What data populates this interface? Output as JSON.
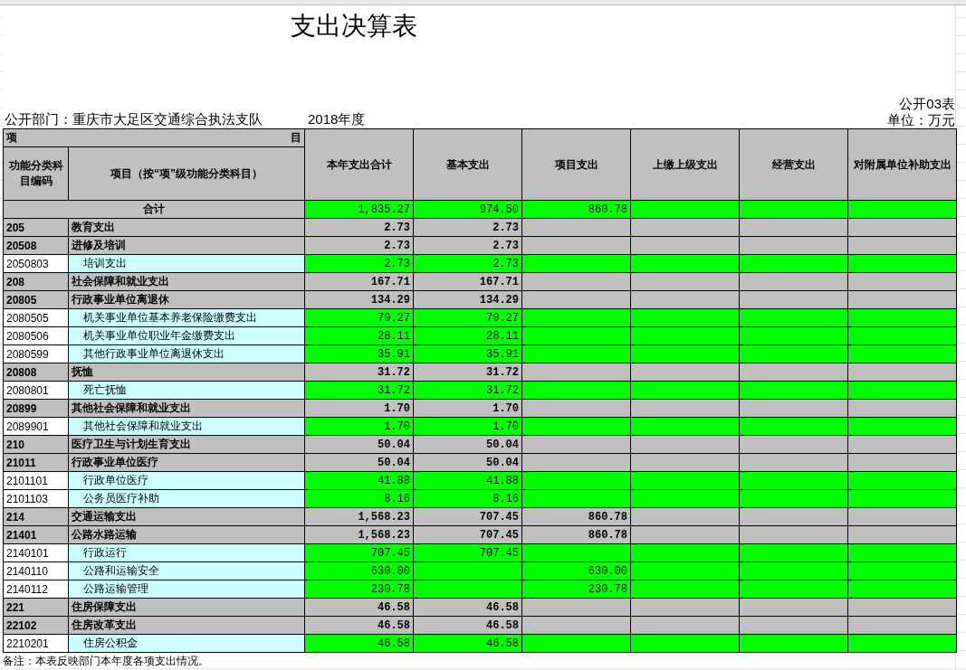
{
  "title": "支出决算表",
  "form_no": "公开03表",
  "department": "公开部门：重庆市大足区交通综合执法支队",
  "year": "2018年度",
  "unit": "单位：万元",
  "header": {
    "group": "项",
    "group_end": "目",
    "code": "功能分类科目编码",
    "name": "项目（按“项”级功能分类科目）",
    "columns": [
      "本年支出合计",
      "基本支出",
      "项目支出",
      "上缴上级支出",
      "经营支出",
      "对附属单位补助支出"
    ]
  },
  "total": {
    "label": "合计",
    "total": "1,835.27",
    "basic": "974.50",
    "project": "860.78"
  },
  "rows": [
    {
      "kind": "category",
      "code": "205",
      "name": "教育支出",
      "total": "2.73",
      "basic": "2.73"
    },
    {
      "kind": "category",
      "code": "20508",
      "name": "进修及培训",
      "total": "2.73",
      "basic": "2.73"
    },
    {
      "kind": "item",
      "code": "2050803",
      "name": "培训支出",
      "total": "2.73",
      "basic": "2.73"
    },
    {
      "kind": "category",
      "code": "208",
      "name": "社会保障和就业支出",
      "total": "167.71",
      "basic": "167.71"
    },
    {
      "kind": "category",
      "code": "20805",
      "name": "行政事业单位离退休",
      "total": "134.29",
      "basic": "134.29"
    },
    {
      "kind": "item",
      "code": "2080505",
      "name": "机关事业单位基本养老保险缴费支出",
      "total": "70.27",
      "basic": "70.27"
    },
    {
      "kind": "item",
      "code": "2080506",
      "name": "机关事业单位职业年金缴费支出",
      "total": "28.11",
      "basic": "28.11"
    },
    {
      "kind": "item",
      "code": "2080599",
      "name": "其他行政事业单位离退休支出",
      "total": "35.91",
      "basic": "35.91"
    },
    {
      "kind": "category",
      "code": "20808",
      "name": "抚恤",
      "total": "31.72",
      "basic": "31.72"
    },
    {
      "kind": "item",
      "code": "2080801",
      "name": "死亡抚恤",
      "total": "31.72",
      "basic": "31.72"
    },
    {
      "kind": "category",
      "code": "20899",
      "name": "其他社会保障和就业支出",
      "total": "1.70",
      "basic": "1.70"
    },
    {
      "kind": "item",
      "code": "2089901",
      "name": "其他社会保障和就业支出",
      "total": "1.70",
      "basic": "1.70"
    },
    {
      "kind": "category",
      "code": "210",
      "name": "医疗卫生与计划生育支出",
      "total": "50.04",
      "basic": "50.04"
    },
    {
      "kind": "category",
      "code": "21011",
      "name": "行政事业单位医疗",
      "total": "50.04",
      "basic": "50.04"
    },
    {
      "kind": "item",
      "code": "2101101",
      "name": "行政单位医疗",
      "total": "41.88",
      "basic": "41.88"
    },
    {
      "kind": "item",
      "code": "2101103",
      "name": "公务员医疗补助",
      "total": "8.16",
      "basic": "8.16"
    },
    {
      "kind": "category",
      "code": "214",
      "name": "交通运输支出",
      "total": "1,568.23",
      "basic": "707.45",
      "project": "860.78"
    },
    {
      "kind": "category",
      "code": "21401",
      "name": "公路水路运输",
      "total": "1,568.23",
      "basic": "707.45",
      "project": "860.78"
    },
    {
      "kind": "item",
      "code": "2140101",
      "name": "行政运行",
      "total": "707.45",
      "basic": "707.45"
    },
    {
      "kind": "item",
      "code": "2140110",
      "name": "公路和运输安全",
      "total": "630.00",
      "project": "630.00"
    },
    {
      "kind": "item",
      "code": "2140112",
      "name": "公路运输管理",
      "total": "230.78",
      "project": "230.78"
    },
    {
      "kind": "category",
      "code": "221",
      "name": "住房保障支出",
      "total": "46.58",
      "basic": "46.58"
    },
    {
      "kind": "category",
      "code": "22102",
      "name": "住房改革支出",
      "total": "46.58",
      "basic": "46.58"
    },
    {
      "kind": "item",
      "code": "2210201",
      "name": "住房公积金",
      "total": "46.58",
      "basic": "46.58"
    }
  ],
  "note": "备注：本表反映部门本年度各项支出情况。"
}
